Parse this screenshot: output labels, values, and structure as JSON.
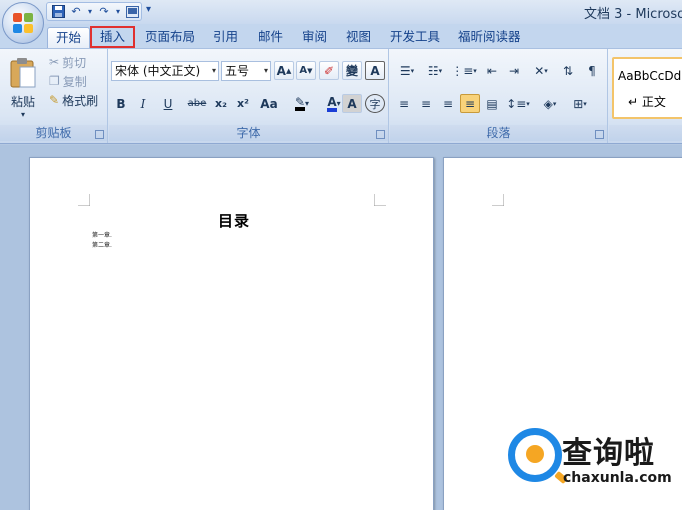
{
  "window": {
    "title": "文档 3 - Microsof"
  },
  "qat": {
    "more": "▾"
  },
  "tabs": [
    {
      "label": "开始"
    },
    {
      "label": "插入"
    },
    {
      "label": "页面布局"
    },
    {
      "label": "引用"
    },
    {
      "label": "邮件"
    },
    {
      "label": "审阅"
    },
    {
      "label": "视图"
    },
    {
      "label": "开发工具"
    },
    {
      "label": "福昕阅读器"
    }
  ],
  "clipboard": {
    "label": "剪贴板",
    "paste": "粘贴",
    "cut": "剪切",
    "copy": "复制",
    "format_painter": "格式刷"
  },
  "font": {
    "label": "字体",
    "family": "宋体 (中文正文)",
    "size": "五号",
    "grow": "A",
    "shrink": "A",
    "phonetic": "變",
    "border_char": "A",
    "bold": "B",
    "italic": "I",
    "underline": "U",
    "strike": "abe",
    "subscript": "x₂",
    "superscript": "x²",
    "case": "Aa",
    "font_color": "A",
    "shade": "A",
    "enclose": "字"
  },
  "paragraph": {
    "label": "段落"
  },
  "styles": {
    "sample": "AaBbCcDdI",
    "normal": "↵ 正文"
  },
  "document": {
    "heading": "目录",
    "lines": [
      "第一章.",
      "第二章."
    ]
  },
  "watermark": {
    "text": "查询啦",
    "url": "chaxunla.com"
  }
}
